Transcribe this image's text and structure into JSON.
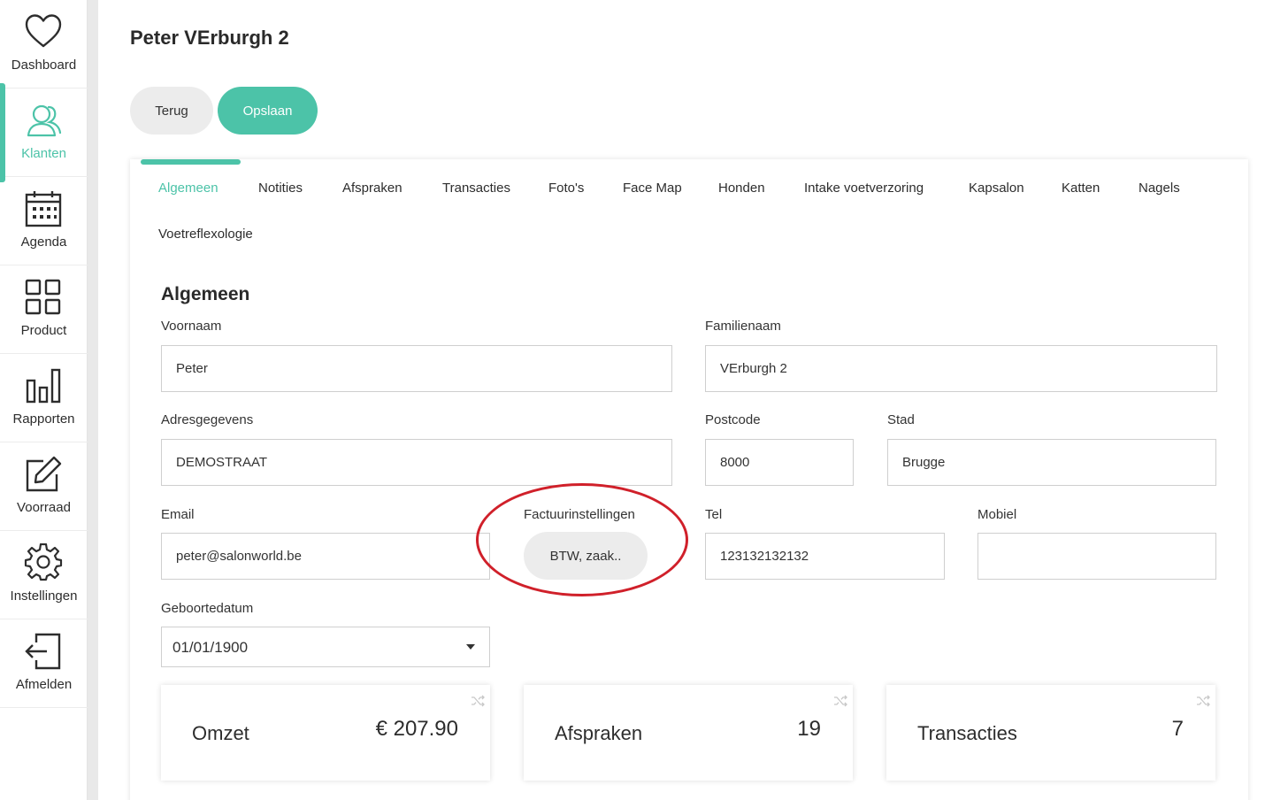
{
  "sidebar": {
    "items": [
      {
        "label": "Dashboard",
        "icon": "heart-icon"
      },
      {
        "label": "Klanten",
        "icon": "users-icon",
        "active": true
      },
      {
        "label": "Agenda",
        "icon": "calendar-icon"
      },
      {
        "label": "Product",
        "icon": "grid-icon"
      },
      {
        "label": "Rapporten",
        "icon": "bar-chart-icon"
      },
      {
        "label": "Voorraad",
        "icon": "edit-icon"
      },
      {
        "label": "Instellingen",
        "icon": "gear-icon"
      },
      {
        "label": "Afmelden",
        "icon": "logout-icon"
      }
    ]
  },
  "header": {
    "title": "Peter VErburgh 2",
    "back_label": "Terug",
    "save_label": "Opslaan"
  },
  "tabs": [
    "Algemeen",
    "Notities",
    "Afspraken",
    "Transacties",
    "Foto's",
    "Face Map",
    "Honden",
    "Intake voetverzoring",
    "Kapsalon",
    "Katten",
    "Nagels",
    "Voetreflexologie"
  ],
  "active_tab": "Algemeen",
  "form": {
    "section_title": "Algemeen",
    "voornaam": {
      "label": "Voornaam",
      "value": "Peter"
    },
    "familienaam": {
      "label": "Familienaam",
      "value": "VErburgh 2"
    },
    "adres": {
      "label": "Adresgegevens",
      "value": "DEMOSTRAAT"
    },
    "postcode": {
      "label": "Postcode",
      "value": "8000"
    },
    "stad": {
      "label": "Stad",
      "value": "Brugge"
    },
    "email": {
      "label": "Email",
      "value": "peter@salonworld.be"
    },
    "factuur": {
      "label": "Factuurinstellingen",
      "button_label": "BTW, zaak.."
    },
    "tel": {
      "label": "Tel",
      "value": "123132132132"
    },
    "mobiel": {
      "label": "Mobiel",
      "value": ""
    },
    "geboortedatum": {
      "label": "Geboortedatum",
      "value": "01/01/1900"
    }
  },
  "stats": [
    {
      "label": "Omzet",
      "value": "€ 207.90"
    },
    {
      "label": "Afspraken",
      "value": "19"
    },
    {
      "label": "Transacties",
      "value": "7"
    }
  ],
  "colors": {
    "accent": "#4cc3a8",
    "highlight_circle": "#d0202a"
  }
}
